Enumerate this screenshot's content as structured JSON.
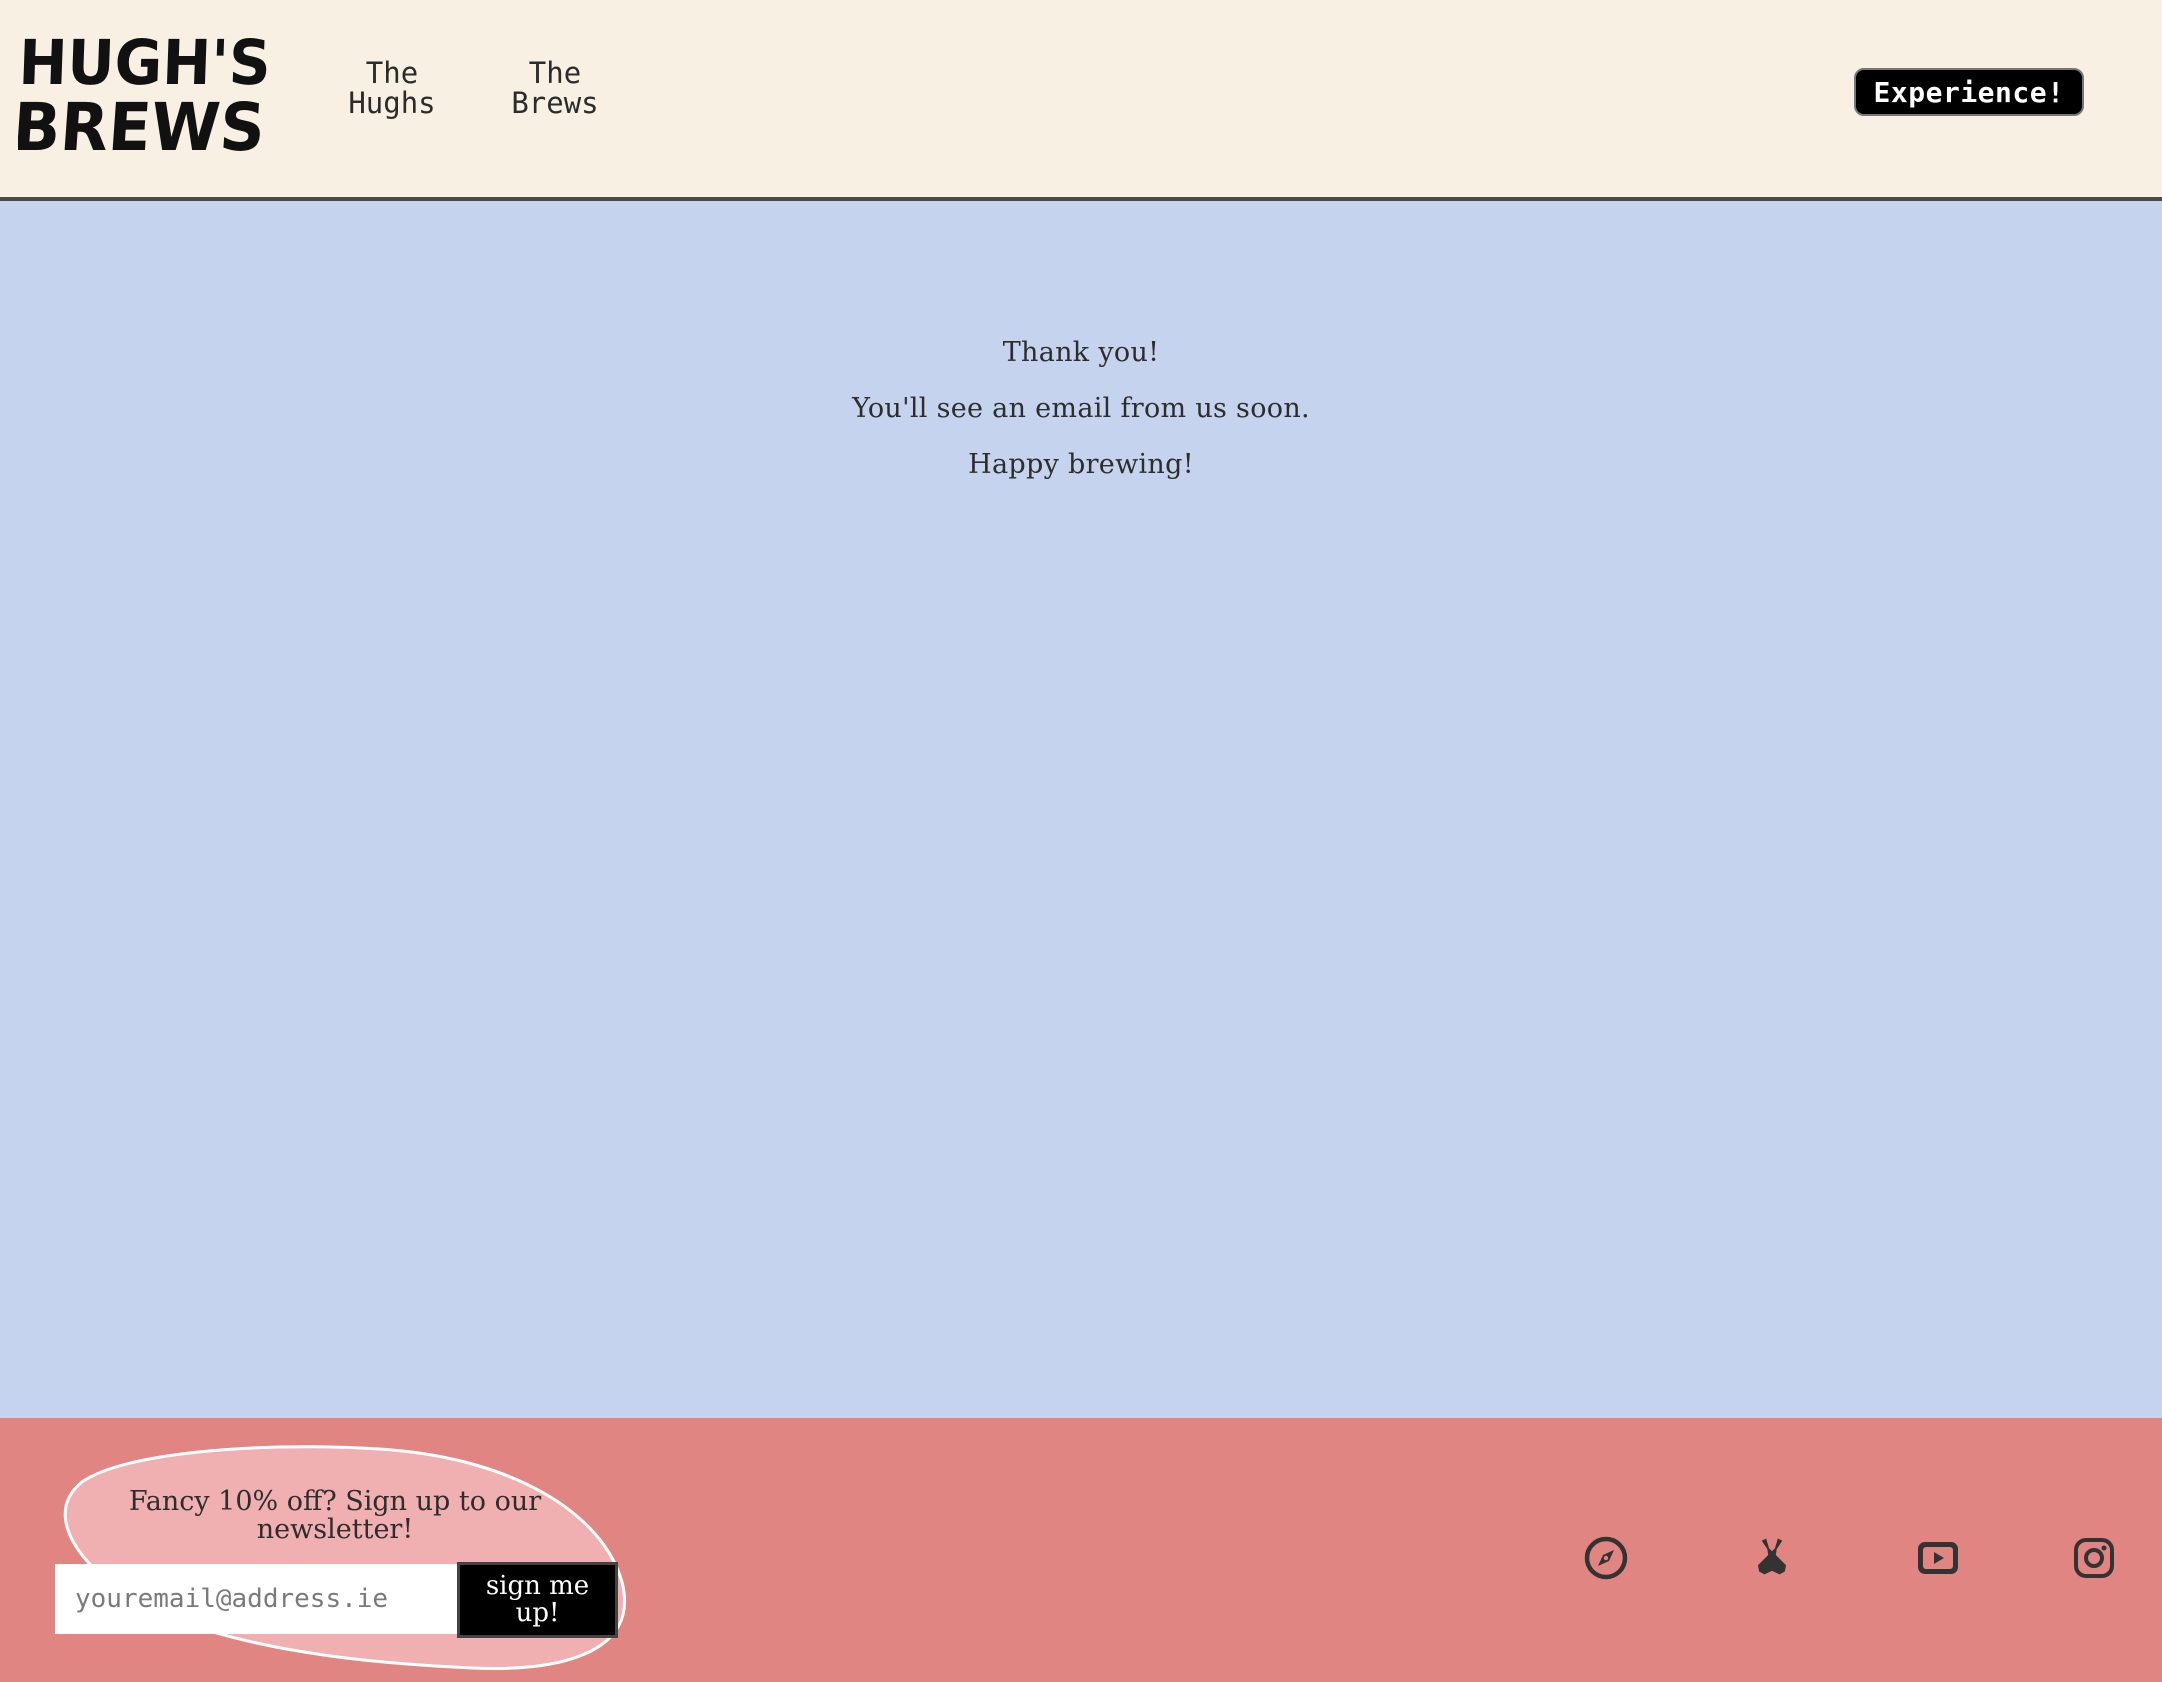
{
  "header": {
    "logo_text": "HUGH'S BREWS",
    "nav": [
      {
        "label": "The\nHughs"
      },
      {
        "label": "The\nBrews"
      }
    ],
    "cta_label": "Experience!"
  },
  "main": {
    "lines": [
      "Thank you!",
      "You'll see an email from us soon.",
      "Happy brewing!"
    ]
  },
  "footer": {
    "newsletter_text": "Fancy 10% off? Sign up to our newsletter!",
    "email_placeholder": "youremail@address.ie",
    "signup_label": "sign me up!",
    "social": [
      {
        "icon": "compass-icon"
      },
      {
        "icon": "crossed-bottles-icon"
      },
      {
        "icon": "youtube-icon"
      },
      {
        "icon": "instagram-icon"
      }
    ]
  },
  "colors": {
    "header_bg": "#f7f0e3",
    "main_bg": "#c5d3ee",
    "footer_bg": "#e08582",
    "blob_bg": "#f0afb1"
  }
}
